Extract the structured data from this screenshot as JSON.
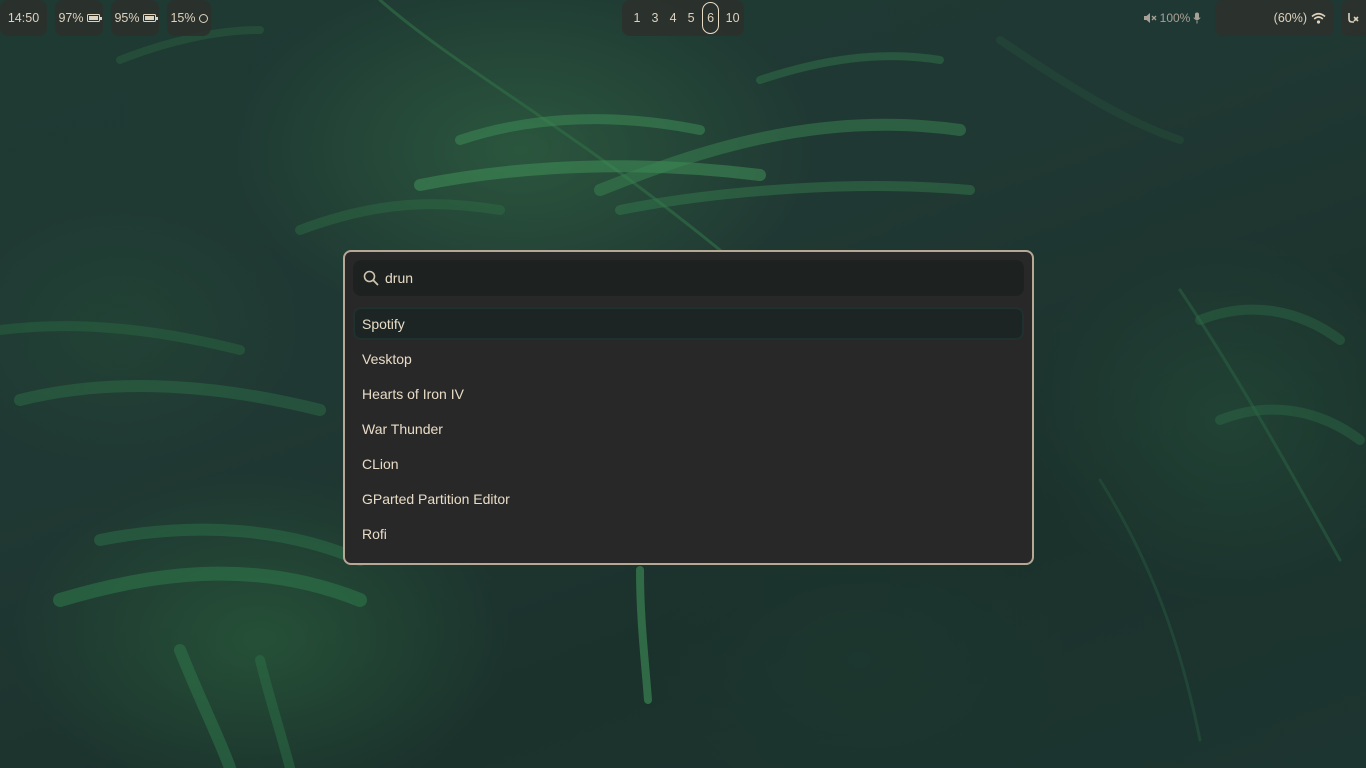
{
  "topbar": {
    "clock": "14:50",
    "battery_1": "97%",
    "battery_2": "95%",
    "brightness": "15%",
    "workspaces": [
      "1",
      "3",
      "4",
      "5",
      "6",
      "10"
    ],
    "active_workspace": "6",
    "volume": "100%",
    "network": "(60%)",
    "status_icons": [
      "battery-icon",
      "battery-icon",
      "moon-icon",
      "speaker-muted-icon",
      "microphone-icon",
      "wifi-icon",
      "notification-icon"
    ]
  },
  "launcher": {
    "search_value": "drun",
    "search_icon": "search-icon",
    "results": [
      "Spotify",
      "Vesktop",
      "Hearts of Iron IV",
      "War Thunder",
      "CLion",
      "GParted Partition Editor",
      "Rofi"
    ],
    "selected_index": 0
  },
  "colors": {
    "accent": "#e8dcc6",
    "launcher_border": "#b5a894",
    "launcher_bg": "#292828",
    "bar_bg": "#2c302c"
  }
}
